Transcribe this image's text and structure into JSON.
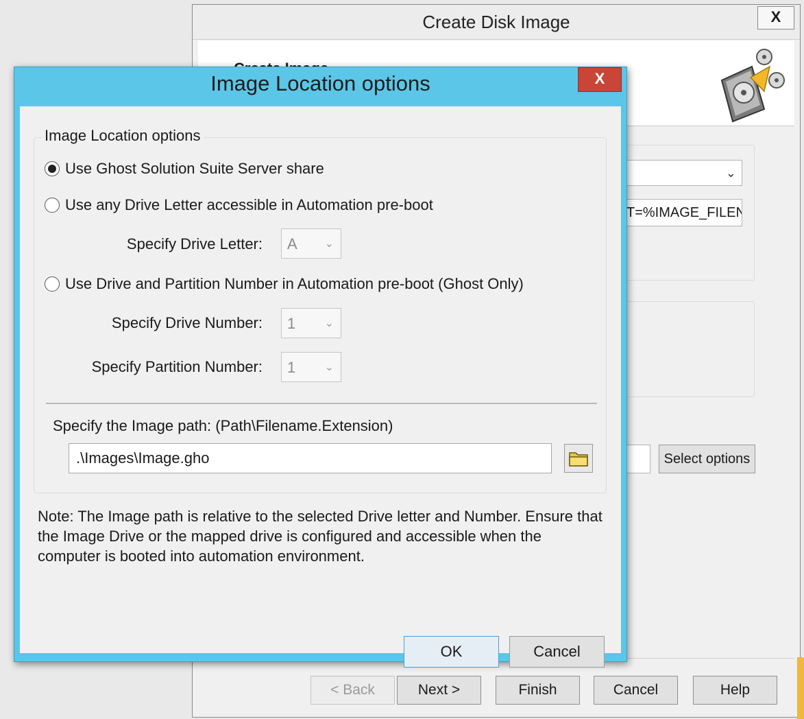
{
  "background_window": {
    "title": "Create Disk Image",
    "close_label": "X",
    "header_title": "Create Image",
    "path_field_value": "T=%IMAGE_FILENAM",
    "select_options_label": "Select options",
    "buttons": {
      "back": "< Back",
      "next": "Next >",
      "finish": "Finish",
      "cancel": "Cancel",
      "help": "Help"
    }
  },
  "dialog": {
    "title": "Image Location options",
    "close_label": "X",
    "group_caption": "Image Location options",
    "options": [
      {
        "label": "Use Ghost Solution Suite Server share",
        "checked": true
      },
      {
        "label": "Use any Drive Letter accessible in Automation pre-boot",
        "checked": false
      },
      {
        "label": "Use Drive and Partition Number in Automation pre-boot (Ghost Only)",
        "checked": false
      }
    ],
    "drive_letter": {
      "label": "Specify Drive Letter:",
      "value": "A"
    },
    "drive_number": {
      "label": "Specify Drive Number:",
      "value": "1"
    },
    "partition_number": {
      "label": "Specify Partition Number:",
      "value": "1"
    },
    "path_label": "Specify the Image path: (Path\\Filename.Extension)",
    "path_value": ".\\Images\\Image.gho",
    "note": "Note: The Image path is relative to the selected Drive letter and Number. Ensure that the Image Drive or the mapped drive is configured and accessible when the computer is booted into automation environment.",
    "ok_label": "OK",
    "cancel_label": "Cancel"
  },
  "colors": {
    "dialog_frame": "#5bc6e8",
    "close_button": "#c84538",
    "accent_strip": "#f0b73e"
  },
  "icons": [
    "disk-image-icon",
    "folder-icon",
    "chevron-down-icon",
    "close-icon"
  ]
}
